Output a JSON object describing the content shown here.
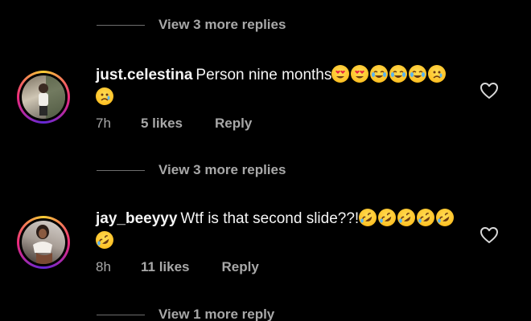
{
  "replies_links": [
    {
      "label": "View 3 more replies"
    },
    {
      "label": "View 3 more replies"
    },
    {
      "label": "View 1 more reply"
    }
  ],
  "comments": [
    {
      "username": "just.celestina",
      "text": "Person nine months",
      "emojis": [
        "heart-eyes-emoji",
        "heart-eyes-emoji",
        "joy-emoji",
        "joy-emoji",
        "joy-emoji",
        "sad-emoji",
        "sad-emoji"
      ],
      "time": "7h",
      "likes": "5 likes",
      "reply_label": "Reply",
      "liked": false
    },
    {
      "username": "jay_beeyyy",
      "text": "Wtf is that second slide??!",
      "emojis": [
        "rofl-emoji",
        "rofl-emoji",
        "rofl-emoji",
        "rofl-emoji",
        "rofl-emoji",
        "rofl-emoji"
      ],
      "time": "8h",
      "likes": "11 likes",
      "reply_label": "Reply",
      "liked": false
    }
  ],
  "colors": {
    "background": "#000000",
    "primary_text": "#f5f5f5",
    "secondary_text": "#a8a8a8"
  }
}
